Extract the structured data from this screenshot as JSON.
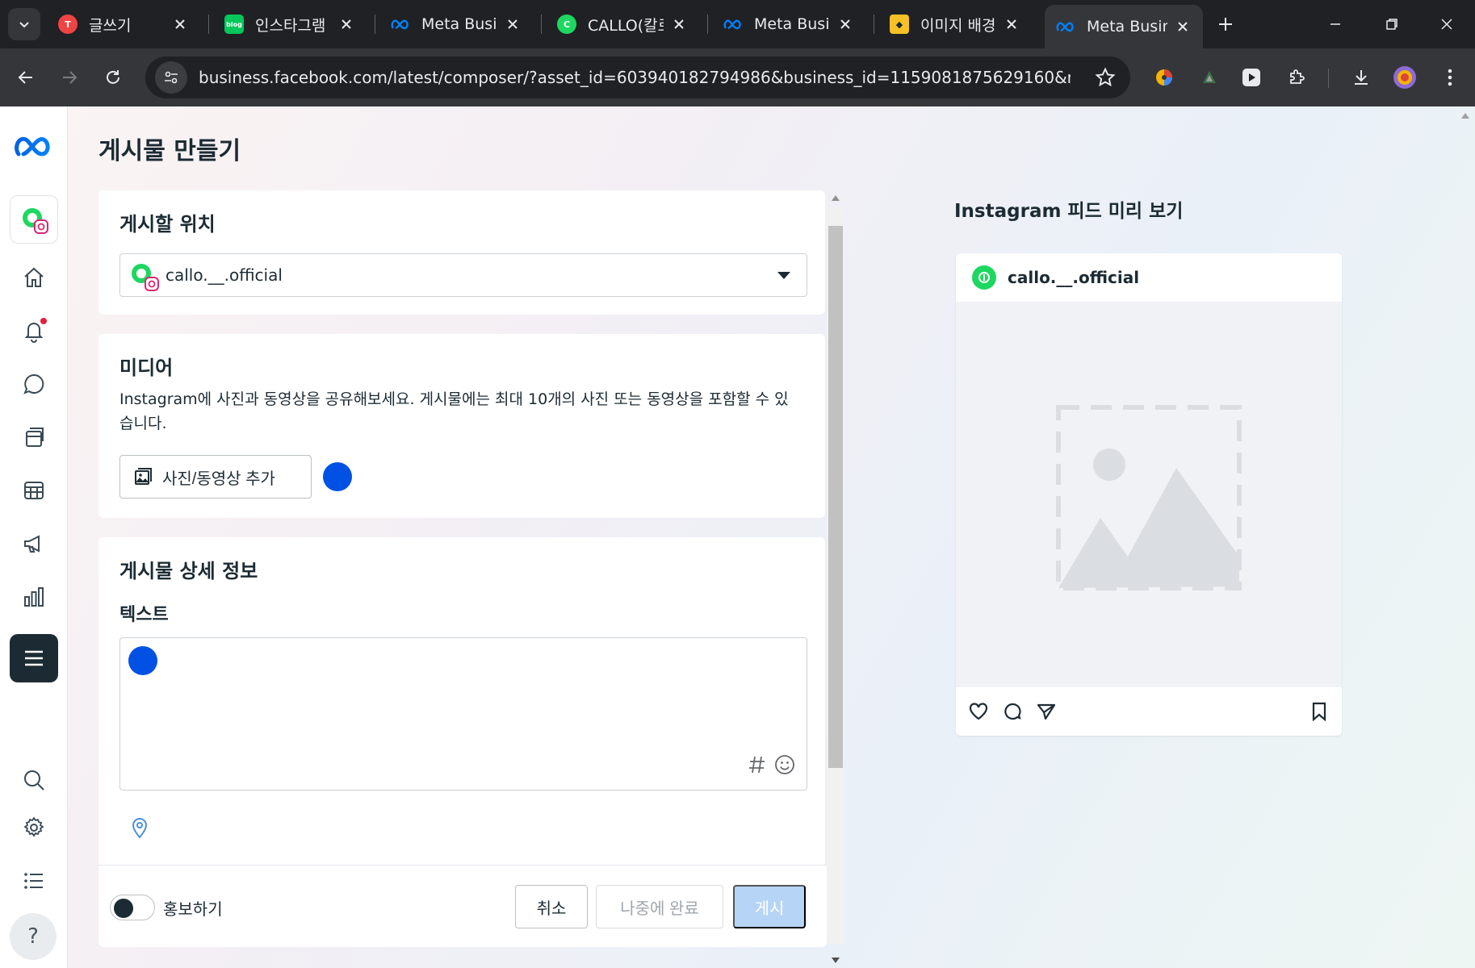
{
  "browser": {
    "tabs": [
      {
        "title": "글쓰기",
        "favicon": "tistory-icon",
        "favicon_color": "#ef4444"
      },
      {
        "title": "인스타그램 ",
        "favicon": "naver-blog-icon",
        "favicon_color": "#03c75a"
      },
      {
        "title": "Meta Busine",
        "favicon": "meta-icon",
        "favicon_color": "#0081fb"
      },
      {
        "title": "CALLO(칼로)",
        "favicon": "callo-icon",
        "favicon_color": "#1ed760"
      },
      {
        "title": "Meta Busine",
        "favicon": "meta-icon",
        "favicon_color": "#0081fb"
      },
      {
        "title": "이미지 배경",
        "favicon": "book-icon",
        "favicon_color": "#f6c026"
      },
      {
        "title": "Meta Busine",
        "favicon": "meta-icon",
        "favicon_color": "#0081fb",
        "active": true
      }
    ],
    "url": "business.facebook.com/latest/composer/?asset_id=603940182794986&business_id=1159081875629160&nav_ref=..."
  },
  "page": {
    "title": "게시물 만들기",
    "location_card": {
      "heading": "게시할 위치",
      "selected_account": "callo.__.official"
    },
    "media_card": {
      "heading": "미디어",
      "description": "Instagram에 사진과 동영상을 공유해보세요. 게시물에는 최대 10개의 사진 또는 동영상을 포함할 수 있습니다.",
      "add_button": "사진/동영상 추가"
    },
    "details_card": {
      "heading": "게시물 상세 정보",
      "text_label": "텍스트"
    },
    "footer": {
      "promote_label": "홍보하기",
      "cancel": "취소",
      "finish_later": "나중에 완료",
      "publish": "게시"
    }
  },
  "preview": {
    "title": "Instagram 피드 미리 보기",
    "account": "callo.__.official"
  },
  "colors": {
    "meta_blue": "#0081fb",
    "accent_blue": "#0051e4",
    "disabled_blue": "#b6d4f5",
    "brand_green": "#1ed760"
  }
}
